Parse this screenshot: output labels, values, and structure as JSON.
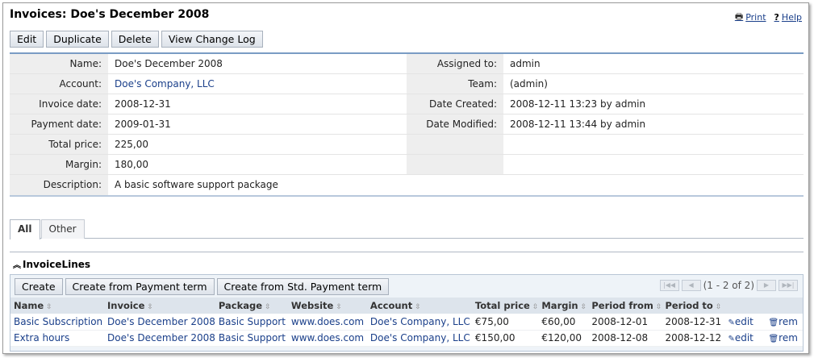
{
  "header": {
    "title": "Invoices: Doe's December 2008",
    "print_label": "Print",
    "help_label": "Help"
  },
  "actions": {
    "edit": "Edit",
    "duplicate": "Duplicate",
    "delete": "Delete",
    "change_log": "View Change Log"
  },
  "detail": {
    "rows": [
      {
        "label": "Name:",
        "value": "Doe's December 2008",
        "label2": "Assigned to:",
        "value2": "admin"
      },
      {
        "label": "Account:",
        "value": "Doe's Company, LLC",
        "label2": "Team:",
        "value2": "(admin)"
      },
      {
        "label": "Invoice date:",
        "value": "2008-12-31",
        "label2": "Date Created:",
        "value2": "2008-12-11 13:23 by admin"
      },
      {
        "label": "Payment date:",
        "value": "2009-01-31",
        "label2": "Date Modified:",
        "value2": "2008-12-11 13:44 by admin"
      },
      {
        "label": "Total price:",
        "value": "225,00",
        "label2": "",
        "value2": ""
      },
      {
        "label": "Margin:",
        "value": "180,00",
        "label2": "",
        "value2": ""
      },
      {
        "label": "Description:",
        "value": "A basic software support package"
      }
    ]
  },
  "tabs": [
    {
      "label": "All"
    },
    {
      "label": "Other"
    }
  ],
  "section": {
    "title": "InvoiceLines"
  },
  "list": {
    "buttons": {
      "create": "Create",
      "create_payment_term": "Create from Payment term",
      "create_std_payment_term": "Create from Std. Payment term"
    },
    "pager": "(1 - 2 of 2)",
    "columns": [
      "Name",
      "Invoice",
      "Package",
      "Website",
      "Account",
      "Total price",
      "Margin",
      "Period from",
      "Period to"
    ],
    "rows": [
      {
        "name": "Basic Subscription",
        "invoice": "Doe's December 2008",
        "package": "Basic Support",
        "website": "www.does.com",
        "account": "Doe's Company, LLC",
        "total": "€75,00",
        "margin": "€60,00",
        "from": "2008-12-01",
        "to": "2008-12-31",
        "edit": "edit",
        "rem": "rem"
      },
      {
        "name": "Extra hours",
        "invoice": "Doe's December 2008",
        "package": "Basic Support",
        "website": "www.does.com",
        "account": "Doe's Company, LLC",
        "total": "€150,00",
        "margin": "€120,00",
        "from": "2008-12-08",
        "to": "2008-12-12",
        "edit": "edit",
        "rem": "rem"
      }
    ]
  }
}
